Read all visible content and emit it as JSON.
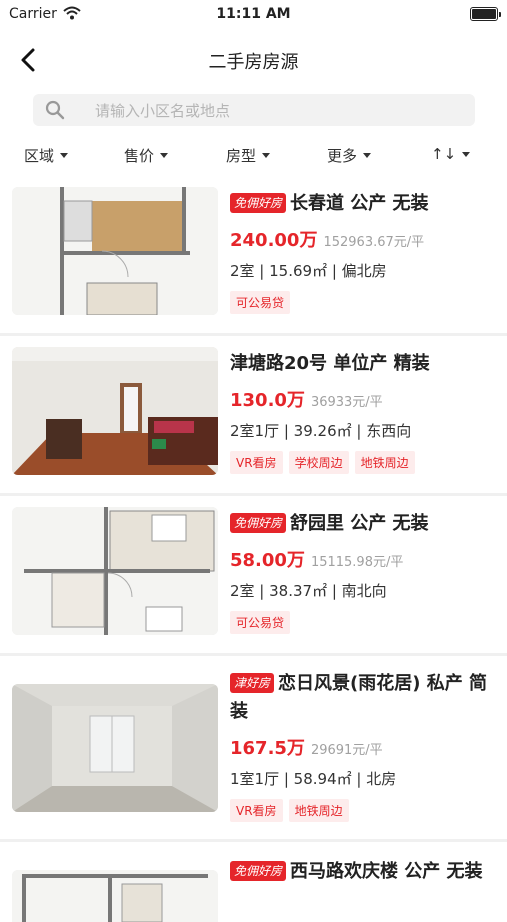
{
  "status_bar": {
    "carrier": "Carrier",
    "time": "11:11 AM"
  },
  "nav": {
    "title": "二手房房源"
  },
  "search": {
    "placeholder": "请输入小区名或地点"
  },
  "filters": [
    {
      "label": "区域"
    },
    {
      "label": "售价"
    },
    {
      "label": "房型"
    },
    {
      "label": "更多"
    },
    {
      "label": "↑↓"
    }
  ],
  "listings": [
    {
      "badge": "免佣好房",
      "title": "长春道 公产 无装",
      "price": "240.00万",
      "unit_price": "152963.67元/平",
      "spec": "2室 | 15.69㎡ | 偏北房",
      "tags": [
        "可公易贷"
      ],
      "image": "floorplan"
    },
    {
      "badge": "",
      "title": "津塘路20号 单位产 精装",
      "price": "130.0万",
      "unit_price": "36933元/平",
      "spec": "2室1厅 | 39.26㎡ | 东西向",
      "tags": [
        "VR看房",
        "学校周边",
        "地铁周边"
      ],
      "image": "room-photo"
    },
    {
      "badge": "免佣好房",
      "title": "舒园里 公产 无装",
      "price": "58.00万",
      "unit_price": "15115.98元/平",
      "spec": "2室 | 38.37㎡ | 南北向",
      "tags": [
        "可公易贷"
      ],
      "image": "floorplan"
    },
    {
      "badge": "津好房",
      "title": "恋日风景(雨花居) 私产 简装",
      "price": "167.5万",
      "unit_price": "29691元/平",
      "spec": "1室1厅 | 58.94㎡ | 北房",
      "tags": [
        "VR看房",
        "地铁周边"
      ],
      "image": "room-photo"
    },
    {
      "badge": "免佣好房",
      "title": "西马路欢庆楼 公产 无装",
      "price": "",
      "unit_price": "",
      "spec": "",
      "tags": [],
      "image": "floorplan"
    }
  ]
}
